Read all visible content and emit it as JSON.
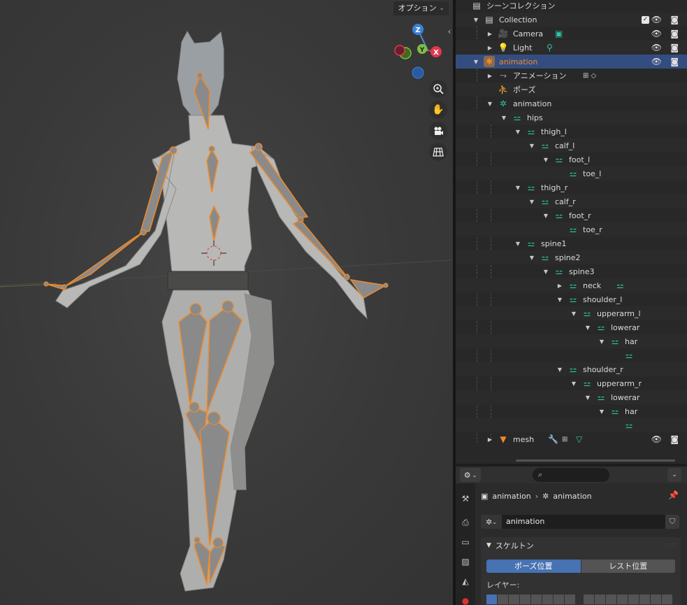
{
  "viewport": {
    "options_label": "オプション",
    "gizmo": {
      "z": "Z",
      "y": "Y",
      "x": "X"
    },
    "tools": [
      "zoom-icon",
      "hand-icon",
      "camera-icon",
      "grid-icon"
    ]
  },
  "outliner": {
    "root": "シーンコレクション",
    "collection": "Collection",
    "camera": "Camera",
    "light": "Light",
    "armature_object": "animation",
    "action": "アニメーション",
    "pose": "ポーズ",
    "armature_data": "animation",
    "bones": {
      "hips": "hips",
      "thigh_l": "thigh_l",
      "calf_l": "calf_l",
      "foot_l": "foot_l",
      "toe_l": "toe_l",
      "thigh_r": "thigh_r",
      "calf_r": "calf_r",
      "foot_r": "foot_r",
      "toe_r": "toe_r",
      "spine1": "spine1",
      "spine2": "spine2",
      "spine3": "spine3",
      "neck": "neck",
      "shoulder_l": "shoulder_l",
      "upperarm_l": "upperarm_l",
      "lowerarm_l": "lowerar",
      "hand_l": "har",
      "shoulder_r": "shoulder_r",
      "upperarm_r": "upperarm_r",
      "lowerarm_r": "lowerar",
      "hand_r": "har"
    },
    "mesh": "mesh"
  },
  "properties": {
    "search_placeholder": "",
    "breadcrumb_object": "animation",
    "breadcrumb_data": "animation",
    "datablock_name": "animation",
    "panel_title": "スケルトン",
    "pose_position": "ポーズ位置",
    "rest_position": "レスト位置",
    "layers_label": "レイヤー:",
    "active_layer_index": 0
  },
  "colors": {
    "selection": "#334d80",
    "bone": "#2ec4a8",
    "armature_orange": "#f08a28",
    "accent_blue": "#4772b3"
  }
}
